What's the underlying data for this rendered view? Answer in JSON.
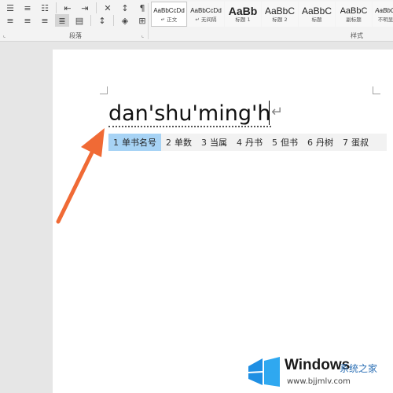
{
  "ribbon": {
    "paragraph_group_label": "段落",
    "styles_group_label": "样式",
    "styles": [
      {
        "sample": "AaBbCcDd",
        "name": "↵ 正文",
        "selected": true
      },
      {
        "sample": "AaBbCcDd",
        "name": "↵ 无间隔",
        "selected": false
      },
      {
        "sample": "AaBb",
        "name": "标题 1",
        "selected": false
      },
      {
        "sample": "AaBbC",
        "name": "标题 2",
        "selected": false
      },
      {
        "sample": "AaBbC",
        "name": "标题",
        "selected": false
      },
      {
        "sample": "AaBbC",
        "name": "副标题",
        "selected": false
      },
      {
        "sample": "AaBbCcDd",
        "name": "不明显强调",
        "selected": false
      }
    ]
  },
  "document": {
    "typed_text": "dan'shu'ming'h",
    "paragraph_mark": "↵"
  },
  "ime": {
    "candidates": [
      {
        "num": "1",
        "text": "单书名号",
        "active": true
      },
      {
        "num": "2",
        "text": "单数",
        "active": false
      },
      {
        "num": "3",
        "text": "当属",
        "active": false
      },
      {
        "num": "4",
        "text": "丹书",
        "active": false
      },
      {
        "num": "5",
        "text": "但书",
        "active": false
      },
      {
        "num": "6",
        "text": "丹树",
        "active": false
      },
      {
        "num": "7",
        "text": "蛋叔",
        "active": false
      }
    ]
  },
  "watermark": {
    "brand": "Windows",
    "cn": "系统之家",
    "url": "www.bjjmlv.com"
  },
  "colors": {
    "arrow": "#f06a35",
    "ime_highlight": "#a7d3f5"
  }
}
